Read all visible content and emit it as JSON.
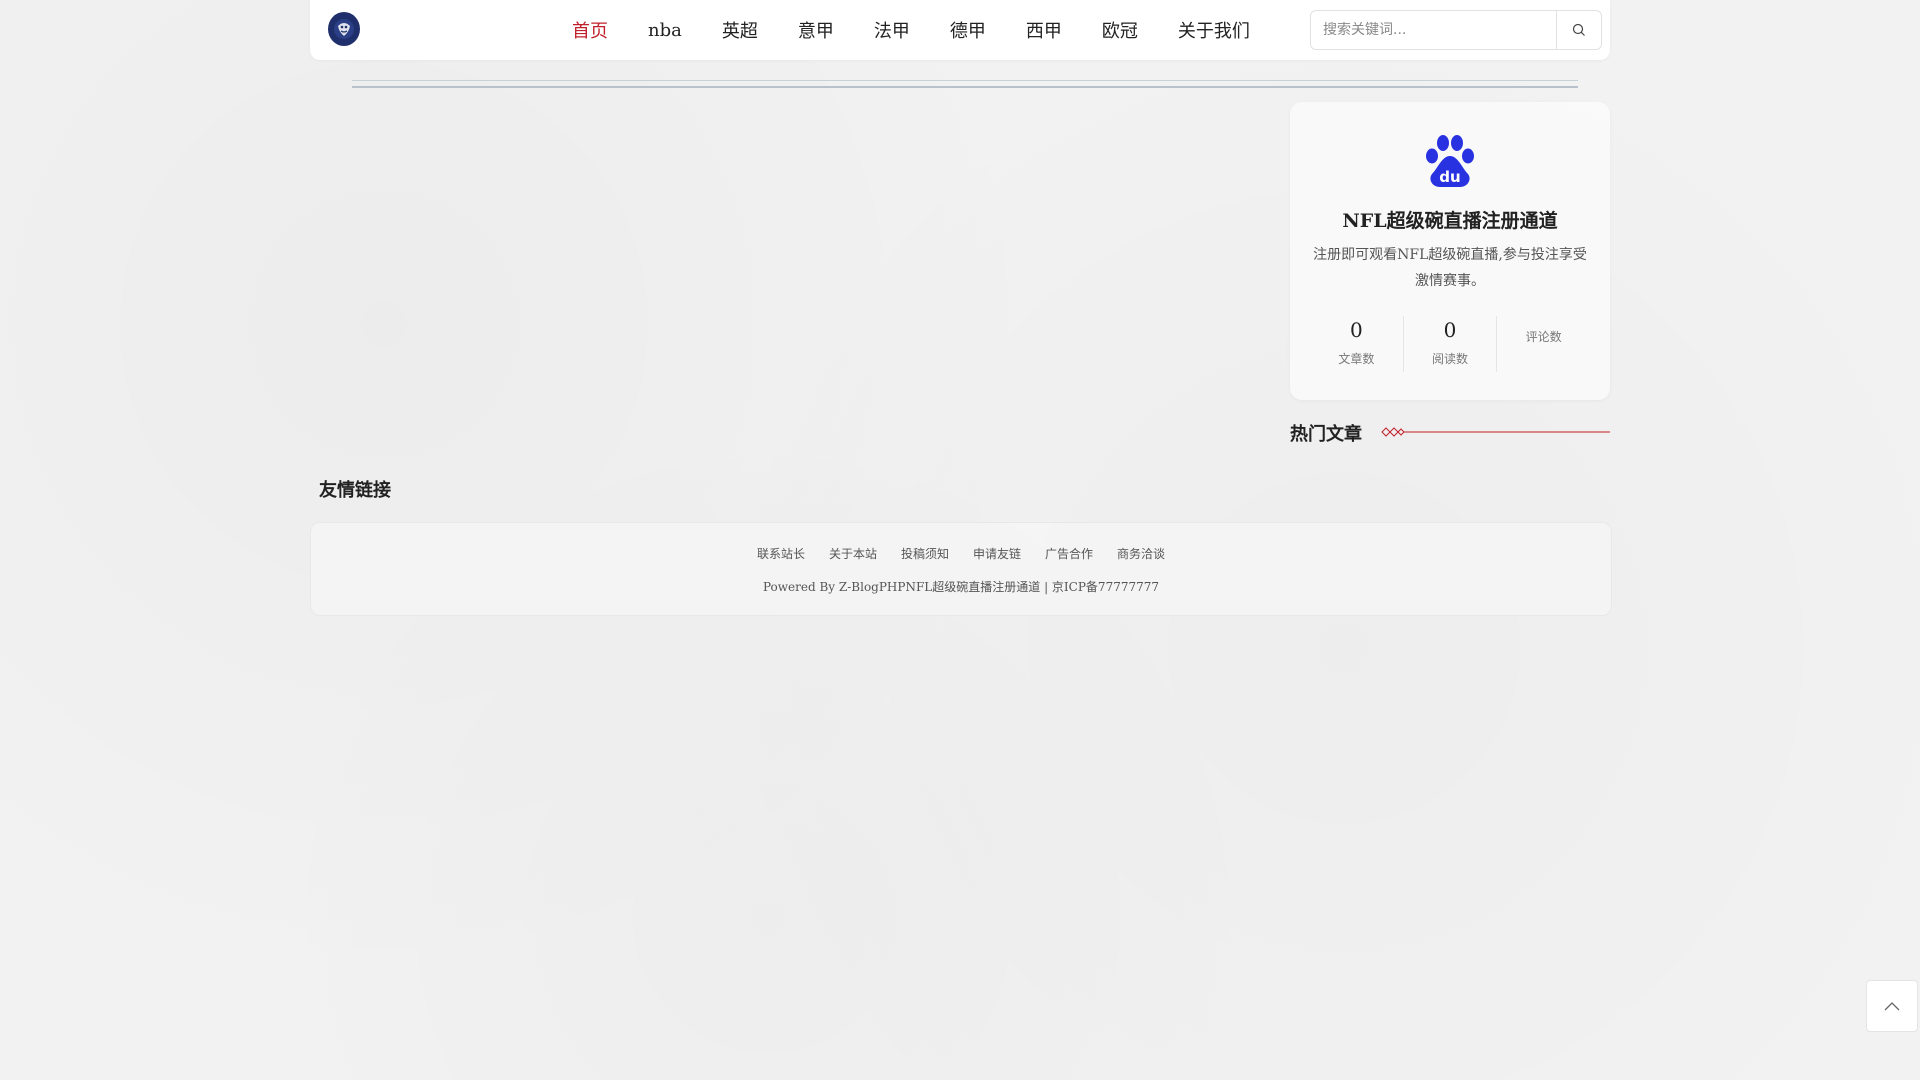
{
  "header": {
    "nav": [
      {
        "label": "首页",
        "active": true
      },
      {
        "label": "nba"
      },
      {
        "label": "英超"
      },
      {
        "label": "意甲"
      },
      {
        "label": "法甲"
      },
      {
        "label": "德甲"
      },
      {
        "label": "西甲"
      },
      {
        "label": "欧冠"
      },
      {
        "label": "关于我们"
      }
    ],
    "search": {
      "placeholder": "搜索关键词...",
      "value": ""
    }
  },
  "profile": {
    "logo_icon": "baidu-paw-icon",
    "name": "NFL超级碗直播注册通道",
    "description": "注册即可观看NFL超级碗直播,参与投注享受激情赛事。",
    "stats": [
      {
        "value": "0",
        "label": "文章数"
      },
      {
        "value": "0",
        "label": "阅读数"
      },
      {
        "value": "",
        "label": "评论数"
      }
    ]
  },
  "hot_articles": {
    "title": "热门文章"
  },
  "links": {
    "title": "友情链接"
  },
  "footer": {
    "links": [
      "联系站长",
      "关于本站",
      "投稿须知",
      "申请友链",
      "广告合作",
      "商务洽谈"
    ],
    "copyright": "Powered By Z-BlogPHPNFL超级碗直播注册通道 | 京ICP备77777777"
  },
  "colors": {
    "accent": "#c0202a",
    "logo": "#1e2f6b",
    "baidu_blue": "#2932e1"
  }
}
